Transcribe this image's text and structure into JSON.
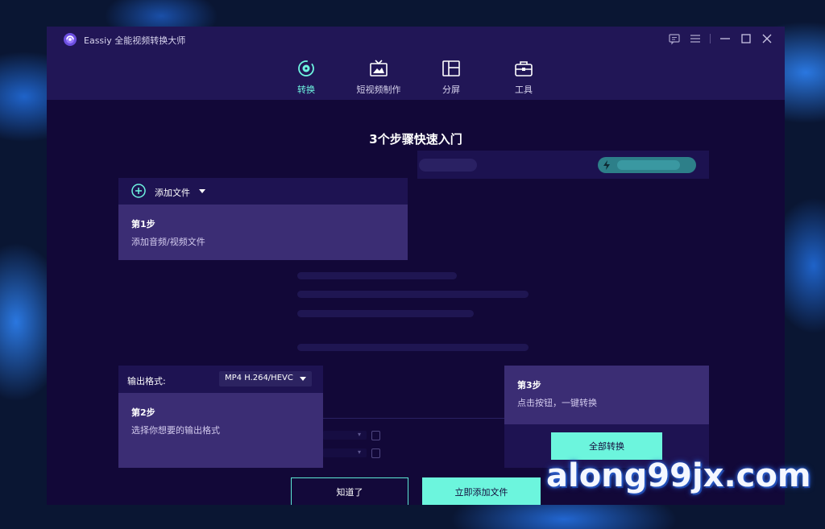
{
  "app": {
    "title": "Eassiy 全能视频转换大师"
  },
  "colors": {
    "accent": "#6cf5dd",
    "titlebar": "#211656",
    "window_bg": "#13093a",
    "tip_bg": "#3b2d74"
  },
  "window_controls": [
    {
      "icon": "feedback-icon"
    },
    {
      "icon": "menu-icon"
    },
    {
      "icon": "minimize-icon"
    },
    {
      "icon": "maximize-icon"
    },
    {
      "icon": "close-icon"
    }
  ],
  "nav": {
    "items": [
      {
        "label": "转换",
        "icon": "convert-icon",
        "active": true
      },
      {
        "label": "短视频制作",
        "icon": "short-video-icon",
        "active": false
      },
      {
        "label": "分屏",
        "icon": "split-screen-icon",
        "active": false
      },
      {
        "label": "工具",
        "icon": "toolbox-icon",
        "active": false
      }
    ]
  },
  "guide": {
    "heading": "3个步骤快速入门",
    "step1": {
      "add_files_label": "添加文件",
      "title": "第1步",
      "desc": "添加音频/视频文件"
    },
    "step2": {
      "format_label": "输出格式:",
      "format_value": "MP4 H.264/HEVC",
      "title": "第2步",
      "desc": "选择你想要的输出格式"
    },
    "step3": {
      "title": "第3步",
      "desc": "点击按钮，一键转换",
      "button": "全部转换"
    },
    "buttons": {
      "got_it": "知道了",
      "add_now": "立即添加文件"
    }
  },
  "watermark": "along99jx.com"
}
